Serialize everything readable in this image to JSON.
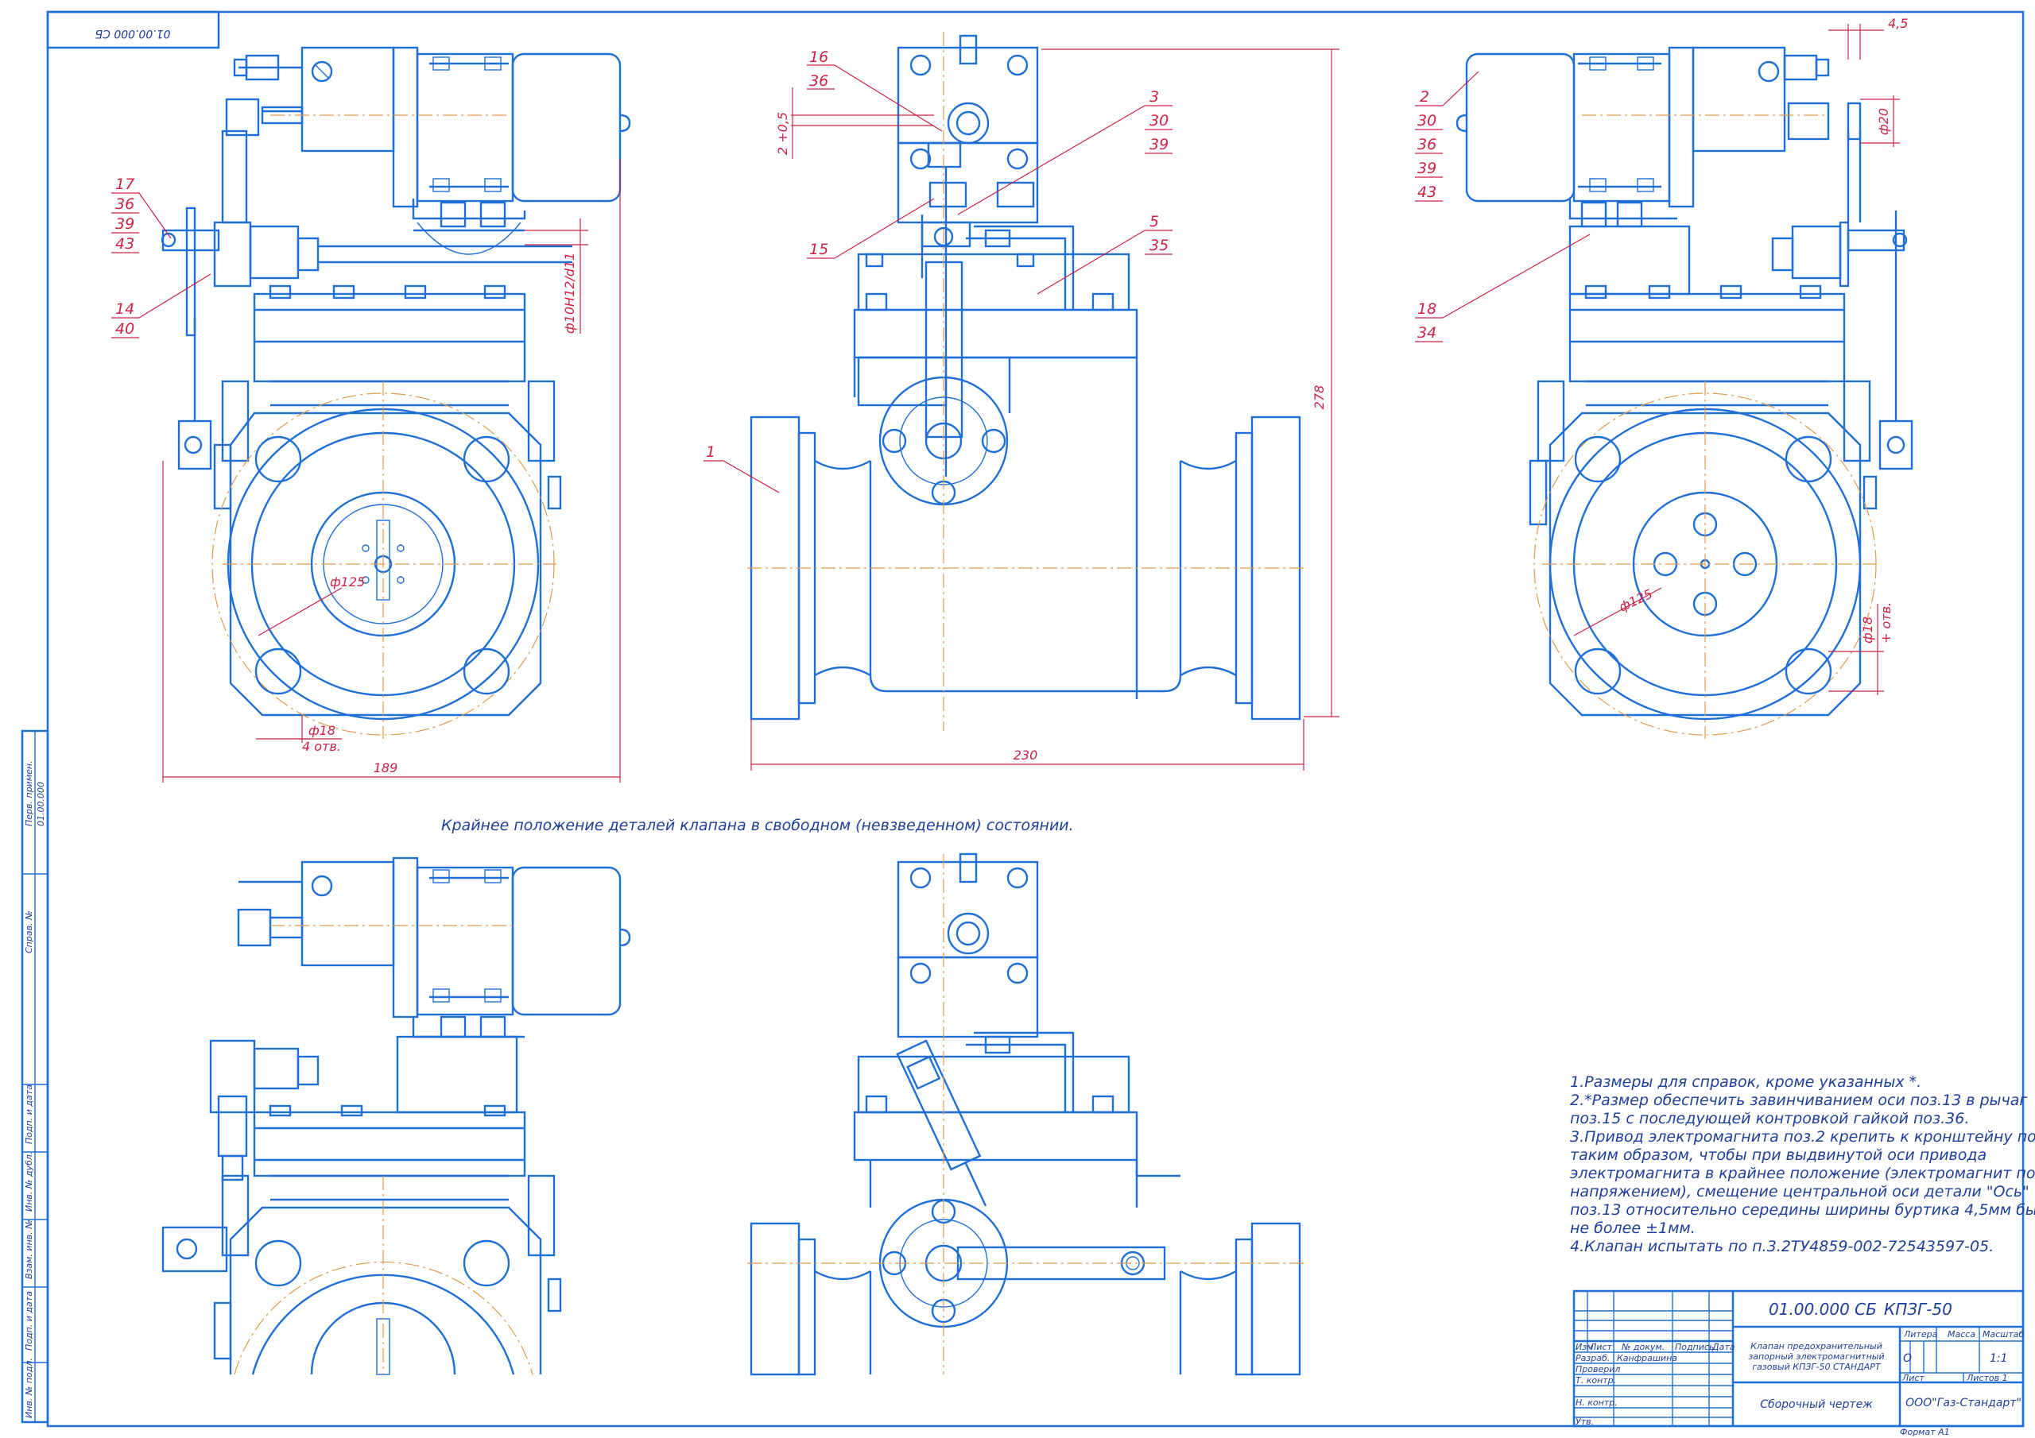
{
  "doc_code_stamp": "01.00.000 СБ",
  "side_strip": {
    "perv_primen_label": "Перв. примен.",
    "perv_primen_value": "01.00.000",
    "sprav_label": "Справ. №",
    "podp_data_1": "Подп. и дата",
    "inv_dubl": "Инв. № дубл.",
    "vzam_inv": "Взам. инв. №",
    "podp_data_2": "Подп. и дата",
    "inv_podl": "Инв. № подл."
  },
  "position_labels": {
    "p17": "17",
    "p36a": "36",
    "p39a": "39",
    "p43a": "43",
    "p14": "14",
    "p40": "40",
    "p16": "16",
    "p36b": "36",
    "p3": "3",
    "p30a": "30",
    "p39b": "39",
    "p15": "15",
    "p5": "5",
    "p35": "35",
    "p1": "1",
    "p2": "2",
    "p30b": "30",
    "p36c": "36",
    "p39c": "39",
    "p43b": "43",
    "p18": "18",
    "p34": "34"
  },
  "dimensions": {
    "d_fit": "ф10H12/d11",
    "d_125_left": "ф125",
    "d_18_left": "ф18",
    "holes": "4 отв.",
    "w189": "189",
    "w230": "230",
    "h278": "278",
    "d_125_right": "ф125",
    "d_18_right": "ф18",
    "d_18_tol": "+ отв.",
    "d_20": "ф20",
    "gap_45": "4,5",
    "gap_2": "2 +0,5"
  },
  "caption": "Крайнее положение деталей клапана в свободном (невзведенном) состоянии.",
  "notes": [
    "1.Размеры для справок, кроме указанных *.",
    "2.*Размер обеспечить завинчиванием оси поз.13 в рычаг",
    "поз.15 с последующей контровкой гайкой поз.36.",
    "3.Привод электромагнита поз.2 крепить к кронштейну поз.1",
    "таким образом, чтобы при выдвинутой оси привода",
    "электромагнита в крайнее положение (электромагнит под",
    "напряжением), смещение центральной оси детали \"Ось\"",
    "поз.13 относительно середины ширины буртика 4,5мм было",
    "не более ±1мм.",
    "4.Клапан испытать по п.3.2ТУ4859-002-72543597-05."
  ],
  "title_block": {
    "doc_number": "01.00.000 СБ",
    "product_code": "КПЗГ-50",
    "col_izm": "Изм",
    "col_list": "Лист",
    "col_ndokum": "№ докум.",
    "col_podpis": "Подпись",
    "col_data": "Дата",
    "row_razrab": "Разраб.",
    "razrab_name": "Канфрашина",
    "row_proveril": "Проверил",
    "row_tkontr": "Т. контр.",
    "row_nkontr": "Н. контр.",
    "row_utv": "Утв.",
    "product_name_1": "Клапан предохранительный",
    "product_name_2": "запорный электромагнитный",
    "product_name_3": "газовый КПЗГ-50 СТАНДАРТ",
    "drawing_type": "Сборочный чертеж",
    "litera_label": "Литера",
    "massa_label": "Масса",
    "masshtab_label": "Масштаб",
    "litera_value": "О",
    "scale_value": "1:1",
    "list_label": "Лист",
    "listov_label": "Листов 1",
    "company": "ООО\"Газ-Стандарт\"",
    "format": "Формат А1"
  },
  "colors": {
    "line": "#1f6fd6",
    "axis": "#e09a4a",
    "dimension": "#cc2244",
    "text": "#1e3f9a"
  }
}
